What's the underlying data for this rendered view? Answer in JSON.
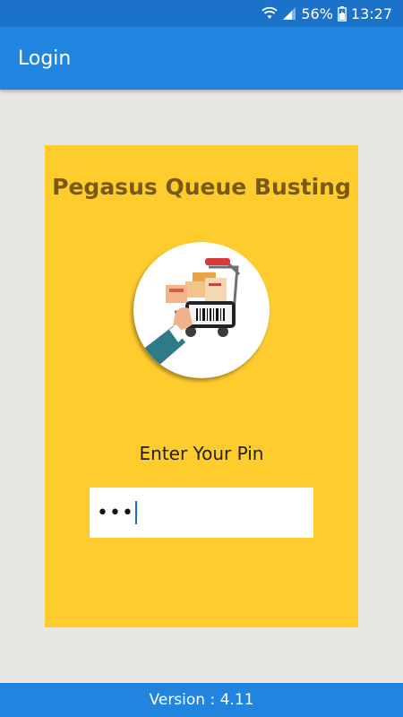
{
  "status_bar": {
    "battery_percent": "56%",
    "time": "13:27",
    "icons": [
      "wifi-icon",
      "signal-icon",
      "battery-icon"
    ]
  },
  "app_bar": {
    "title": "Login"
  },
  "card": {
    "heading": "Pegasus Queue Busting",
    "logo_icon": "shopping-cart-phone-barcode-icon",
    "pin_label": "Enter Your Pin",
    "pin_value": "•••"
  },
  "footer": {
    "version": "Version : 4.11"
  },
  "colors": {
    "status_bar": "#1a73c9",
    "app_bar": "#2184de",
    "card": "#ffcc2e",
    "heading": "#7a5a12",
    "background": "#e9e7e4"
  }
}
